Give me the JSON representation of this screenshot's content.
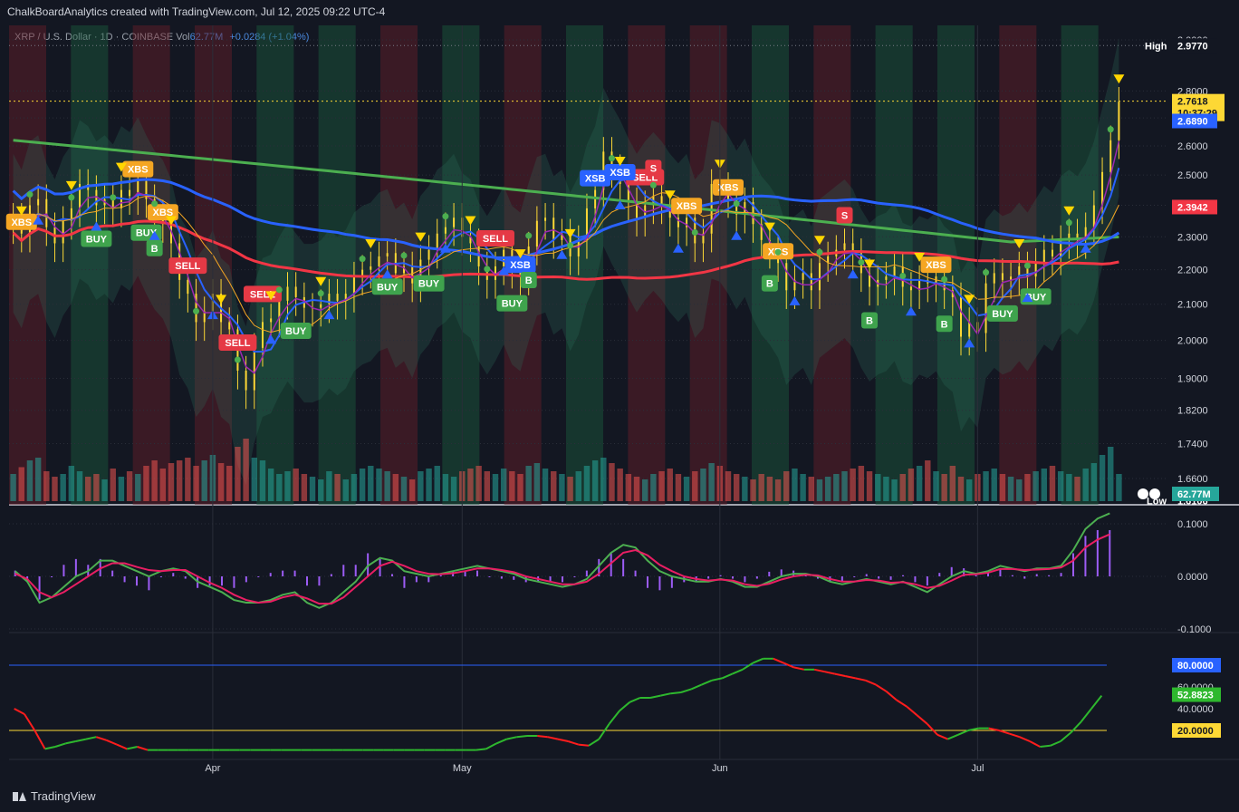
{
  "caption": "ChalkBoardAnalytics created with TradingView.com, Jul 12, 2025 09:22 UTC-4",
  "header": {
    "symbol": "XRP / U.S. Dollar · 1D · COINBASE",
    "vol_label": "Vol",
    "vol_value": "62.77M",
    "change": "+0.0284 (+1.04%)"
  },
  "footer": {
    "brand": "TradingView"
  },
  "colors": {
    "bg": "#131722",
    "up": "#26a69a",
    "down": "#ef5350",
    "bull_zone": "#1b5e3f",
    "bear_zone": "#6b1f2a",
    "ma_green": "#4caf50",
    "ma_blue": "#2962ff",
    "ma_red": "#f23645",
    "macd_line": "#4caf50",
    "signal_line": "#e91e63",
    "hist": "#9c5cf5",
    "stoch_line": "#ff1d1d",
    "stoch_alt": "#2eb82e",
    "price_axis": "#d1d4dc",
    "buy_tag": "#3fa34d",
    "sell_tag": "#e53945",
    "xbs_tag": "#f5a623",
    "xsb_tag": "#2962ff",
    "up_triangle": "#2962ff",
    "down_triangle": "#ffd600"
  },
  "chart_data": [
    {
      "type": "candlestick",
      "title": "XRP / U.S. Dollar · 1D · COINBASE",
      "x_ticks": [
        "Apr",
        "May",
        "Jun",
        "Jul"
      ],
      "y_ticks": [
        "3.0000",
        "2.8000",
        "2.7000",
        "2.6000",
        "2.5000",
        "2.4000",
        "2.3000",
        "2.2000",
        "2.1000",
        "2.0000",
        "1.9000",
        "1.8200",
        "1.7400",
        "1.6600"
      ],
      "ylim": [
        1.6106,
        2.977
      ],
      "y_scale": "log",
      "high": {
        "label": "High",
        "value": "2.9770"
      },
      "low": {
        "label": "Low",
        "value": "1.6106"
      },
      "last_price": {
        "value": "2.7618",
        "countdown": "10:37:29"
      },
      "marker_levels": [
        {
          "value": "2.6890",
          "color": "#2962ff"
        },
        {
          "value": "2.3942",
          "color": "#f23645"
        }
      ],
      "volume_badge": "62.77M",
      "close": [
        2.36,
        2.31,
        2.4,
        2.42,
        2.33,
        2.28,
        2.35,
        2.39,
        2.47,
        2.45,
        2.4,
        2.42,
        2.39,
        2.45,
        2.43,
        2.48,
        2.42,
        2.37,
        2.34,
        2.28,
        2.17,
        2.13,
        2.05,
        2.08,
        2.13,
        2.05,
        2.03,
        1.92,
        1.87,
        1.98,
        2.05,
        2.06,
        2.11,
        2.15,
        2.12,
        2.09,
        2.09,
        2.1,
        2.13,
        2.11,
        2.13,
        2.18,
        2.2,
        2.21,
        2.24,
        2.25,
        2.19,
        2.21,
        2.16,
        2.23,
        2.26,
        2.31,
        2.33,
        2.36,
        2.3,
        2.28,
        2.21,
        2.17,
        2.21,
        2.26,
        2.2,
        2.18,
        2.27,
        2.35,
        2.36,
        2.29,
        2.31,
        2.24,
        2.29,
        2.39,
        2.45,
        2.58,
        2.52,
        2.47,
        2.41,
        2.36,
        2.4,
        2.43,
        2.4,
        2.36,
        2.33,
        2.36,
        2.28,
        2.31,
        2.47,
        2.46,
        2.42,
        2.37,
        2.41,
        2.34,
        2.29,
        2.26,
        2.22,
        2.14,
        2.17,
        2.19,
        2.14,
        2.22,
        2.24,
        2.26,
        2.28,
        2.25,
        2.19,
        2.15,
        2.17,
        2.18,
        2.21,
        2.15,
        2.14,
        2.17,
        2.16,
        2.18,
        2.14,
        2.12,
        2.01,
        2.05,
        2.02,
        2.16,
        2.19,
        2.17,
        2.18,
        2.21,
        2.18,
        2.22,
        2.26,
        2.24,
        2.29,
        2.31,
        2.29,
        2.33,
        2.4,
        2.51,
        2.62,
        2.76
      ],
      "volume": [
        20,
        25,
        30,
        32,
        22,
        18,
        20,
        26,
        22,
        18,
        20,
        16,
        24,
        18,
        22,
        20,
        26,
        30,
        24,
        28,
        30,
        32,
        26,
        30,
        34,
        28,
        26,
        40,
        46,
        32,
        30,
        24,
        20,
        22,
        24,
        20,
        18,
        16,
        22,
        20,
        16,
        20,
        24,
        26,
        24,
        22,
        20,
        18,
        16,
        22,
        24,
        26,
        20,
        18,
        22,
        24,
        26,
        22,
        20,
        24,
        22,
        20,
        26,
        28,
        24,
        22,
        20,
        18,
        22,
        26,
        30,
        32,
        28,
        24,
        20,
        18,
        16,
        20,
        22,
        24,
        20,
        18,
        22,
        24,
        28,
        26,
        22,
        20,
        18,
        16,
        20,
        18,
        16,
        22,
        24,
        20,
        18,
        16,
        18,
        20,
        22,
        24,
        26,
        22,
        20,
        18,
        16,
        20,
        24,
        26,
        30,
        22,
        20,
        26,
        18,
        16,
        20,
        22,
        24,
        20,
        18,
        16,
        20,
        22,
        24,
        26,
        22,
        20,
        18,
        24,
        28,
        34,
        40,
        20
      ],
      "zones": [
        "bear",
        "bull",
        "bear",
        "bear",
        "bull",
        "bull",
        "bear",
        "bull",
        "bear",
        "bull",
        "bear",
        "bear",
        "bull",
        "bear",
        "bull",
        "bull",
        "bear",
        "bull"
      ],
      "signals": {
        "BUY": [
          "BUY",
          "BUY",
          "BUY",
          "BUY",
          "BUY",
          "BUY",
          "BUY",
          "BUY"
        ],
        "SELL": [
          "SELL",
          "SELL",
          "SELL",
          "SELL",
          "SELL"
        ],
        "XBS": [
          "XBS",
          "XBS",
          "XBS",
          "XBS",
          "XBS",
          "XBS",
          "XBS"
        ],
        "XSB": [
          "XSB",
          "XSB",
          "XSB"
        ],
        "B": [
          "B",
          "B",
          "B",
          "B",
          "B"
        ],
        "S": [
          "S",
          "S"
        ]
      }
    },
    {
      "type": "line",
      "title": "MACD",
      "y_ticks": [
        "0.1000",
        "0.0000",
        "-0.1000"
      ],
      "ylim": [
        -0.1,
        0.12
      ],
      "series": [
        {
          "values": [
            0.01,
            -0.01,
            -0.05,
            -0.04,
            -0.02,
            0.0,
            0.01,
            0.03,
            0.03,
            0.02,
            0.01,
            0.0,
            0.01,
            0.015,
            0.01,
            -0.01,
            -0.02,
            -0.03,
            -0.045,
            -0.05,
            -0.05,
            -0.045,
            -0.035,
            -0.03,
            -0.05,
            -0.06,
            -0.05,
            -0.03,
            -0.01,
            0.02,
            0.035,
            0.03,
            0.01,
            0.005,
            0.0,
            0.005,
            0.01,
            0.015,
            0.02,
            0.015,
            0.01,
            0.005,
            -0.005,
            -0.01,
            -0.015,
            -0.02,
            -0.015,
            -0.005,
            0.02,
            0.045,
            0.06,
            0.055,
            0.03,
            0.01,
            0.0,
            -0.005,
            -0.01,
            -0.01,
            -0.005,
            -0.01,
            -0.02,
            -0.02,
            -0.01,
            0.0,
            0.005,
            0.005,
            0.0,
            -0.01,
            -0.015,
            -0.01,
            -0.005,
            -0.01,
            -0.015,
            -0.01,
            -0.02,
            -0.03,
            -0.015,
            0.0,
            0.01,
            0.005,
            0.01,
            0.02,
            0.015,
            0.01,
            0.015,
            0.015,
            0.02,
            0.05,
            0.09,
            0.11,
            0.12
          ]
        },
        {
          "values": [
            0.005,
            -0.005,
            -0.03,
            -0.04,
            -0.03,
            -0.015,
            0.0,
            0.015,
            0.025,
            0.025,
            0.018,
            0.012,
            0.01,
            0.012,
            0.012,
            0.0,
            -0.012,
            -0.022,
            -0.035,
            -0.045,
            -0.05,
            -0.048,
            -0.04,
            -0.035,
            -0.042,
            -0.052,
            -0.052,
            -0.04,
            -0.02,
            0.0,
            0.02,
            0.028,
            0.02,
            0.01,
            0.005,
            0.004,
            0.006,
            0.01,
            0.015,
            0.015,
            0.012,
            0.008,
            0.0,
            -0.005,
            -0.01,
            -0.015,
            -0.015,
            -0.01,
            0.005,
            0.025,
            0.045,
            0.05,
            0.04,
            0.022,
            0.01,
            0.0,
            -0.005,
            -0.008,
            -0.006,
            -0.008,
            -0.015,
            -0.018,
            -0.014,
            -0.006,
            0.0,
            0.003,
            0.002,
            -0.005,
            -0.01,
            -0.01,
            -0.007,
            -0.008,
            -0.012,
            -0.011,
            -0.015,
            -0.022,
            -0.018,
            -0.008,
            0.003,
            0.004,
            0.007,
            0.014,
            0.014,
            0.012,
            0.013,
            0.014,
            0.017,
            0.03,
            0.055,
            0.07,
            0.08
          ]
        }
      ]
    },
    {
      "type": "line",
      "title": "Stochastic RSI",
      "y_ticks": [
        "60.0000",
        "40.0000"
      ],
      "ylim": [
        0,
        100
      ],
      "upper_band": "80.0000",
      "lower_band": "20.0000",
      "last_value": "52.8823",
      "series": [
        {
          "values": [
            40,
            35,
            20,
            3,
            5,
            8,
            10,
            12,
            14,
            11,
            7,
            3,
            5,
            2,
            2,
            2,
            2,
            2,
            2,
            2,
            2,
            2,
            2,
            2,
            2,
            2,
            2,
            2,
            2,
            2,
            2,
            2,
            2,
            2,
            2,
            2,
            2,
            2,
            2,
            2,
            2,
            2,
            2,
            2,
            2,
            2,
            3,
            8,
            12,
            14,
            15,
            15,
            14,
            12,
            10,
            7,
            6,
            12,
            26,
            38,
            46,
            50,
            50,
            52,
            54,
            55,
            58,
            62,
            66,
            68,
            72,
            76,
            82,
            86,
            86,
            82,
            78,
            76,
            76,
            74,
            72,
            70,
            68,
            66,
            62,
            56,
            48,
            42,
            34,
            26,
            16,
            12,
            16,
            20,
            22,
            22,
            20,
            17,
            14,
            10,
            5,
            6,
            10,
            18,
            28,
            40,
            52
          ]
        }
      ]
    }
  ]
}
